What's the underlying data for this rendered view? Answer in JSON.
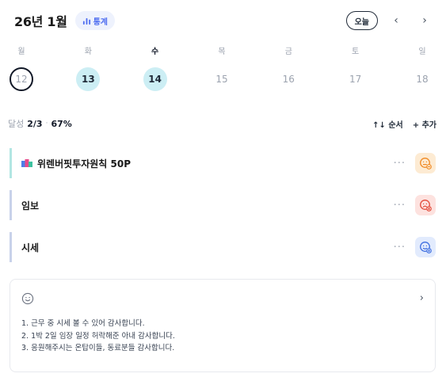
{
  "header": {
    "month_title": "26년 1월",
    "stats_label": "통계",
    "today_label": "오늘",
    "prev_icon": "chevron-left-icon",
    "next_icon": "chevron-right-icon"
  },
  "week": {
    "days": [
      {
        "dow": "월",
        "date": "12",
        "state": "today",
        "dow_active": false
      },
      {
        "dow": "화",
        "date": "13",
        "state": "done",
        "dow_active": false
      },
      {
        "dow": "수",
        "date": "14",
        "state": "done",
        "dow_active": true
      },
      {
        "dow": "목",
        "date": "15",
        "state": "none",
        "dow_active": false
      },
      {
        "dow": "금",
        "date": "16",
        "state": "none",
        "dow_active": false
      },
      {
        "dow": "토",
        "date": "17",
        "state": "none",
        "dow_active": false
      },
      {
        "dow": "일",
        "date": "18",
        "state": "none",
        "dow_active": false
      }
    ]
  },
  "summary": {
    "label": "달성",
    "count": "2/3",
    "separator": "·",
    "percent": "67%",
    "order_label": "↑↓ 순서",
    "add_label": "+ 추가"
  },
  "tasks": [
    {
      "title": "위렌버핏투자원칙 50P",
      "icon": "book-icon",
      "more": "···",
      "status": "orange"
    },
    {
      "title": "임보",
      "icon": "",
      "more": "···",
      "status": "red"
    },
    {
      "title": "시세",
      "icon": "",
      "more": "···",
      "status": "blue"
    }
  ],
  "gratitude": {
    "emoji_icon": "smile-icon",
    "chevron_icon": "chevron-right-icon",
    "lines": [
      "1. 근무 중 시세 볼 수 있어 감사합니다.",
      "2. 1박 2일 임장 일정 허락해준 아내 감사합니다.",
      "3. 응원해주시는 온탑이들, 동료분들 감사합니다."
    ]
  },
  "colors": {
    "accent_blue": "#4f6ef0",
    "done_teal": "#cceef4",
    "status_orange": "#f08a24",
    "status_red": "#e24b3b",
    "status_blue": "#3f6fe0"
  }
}
